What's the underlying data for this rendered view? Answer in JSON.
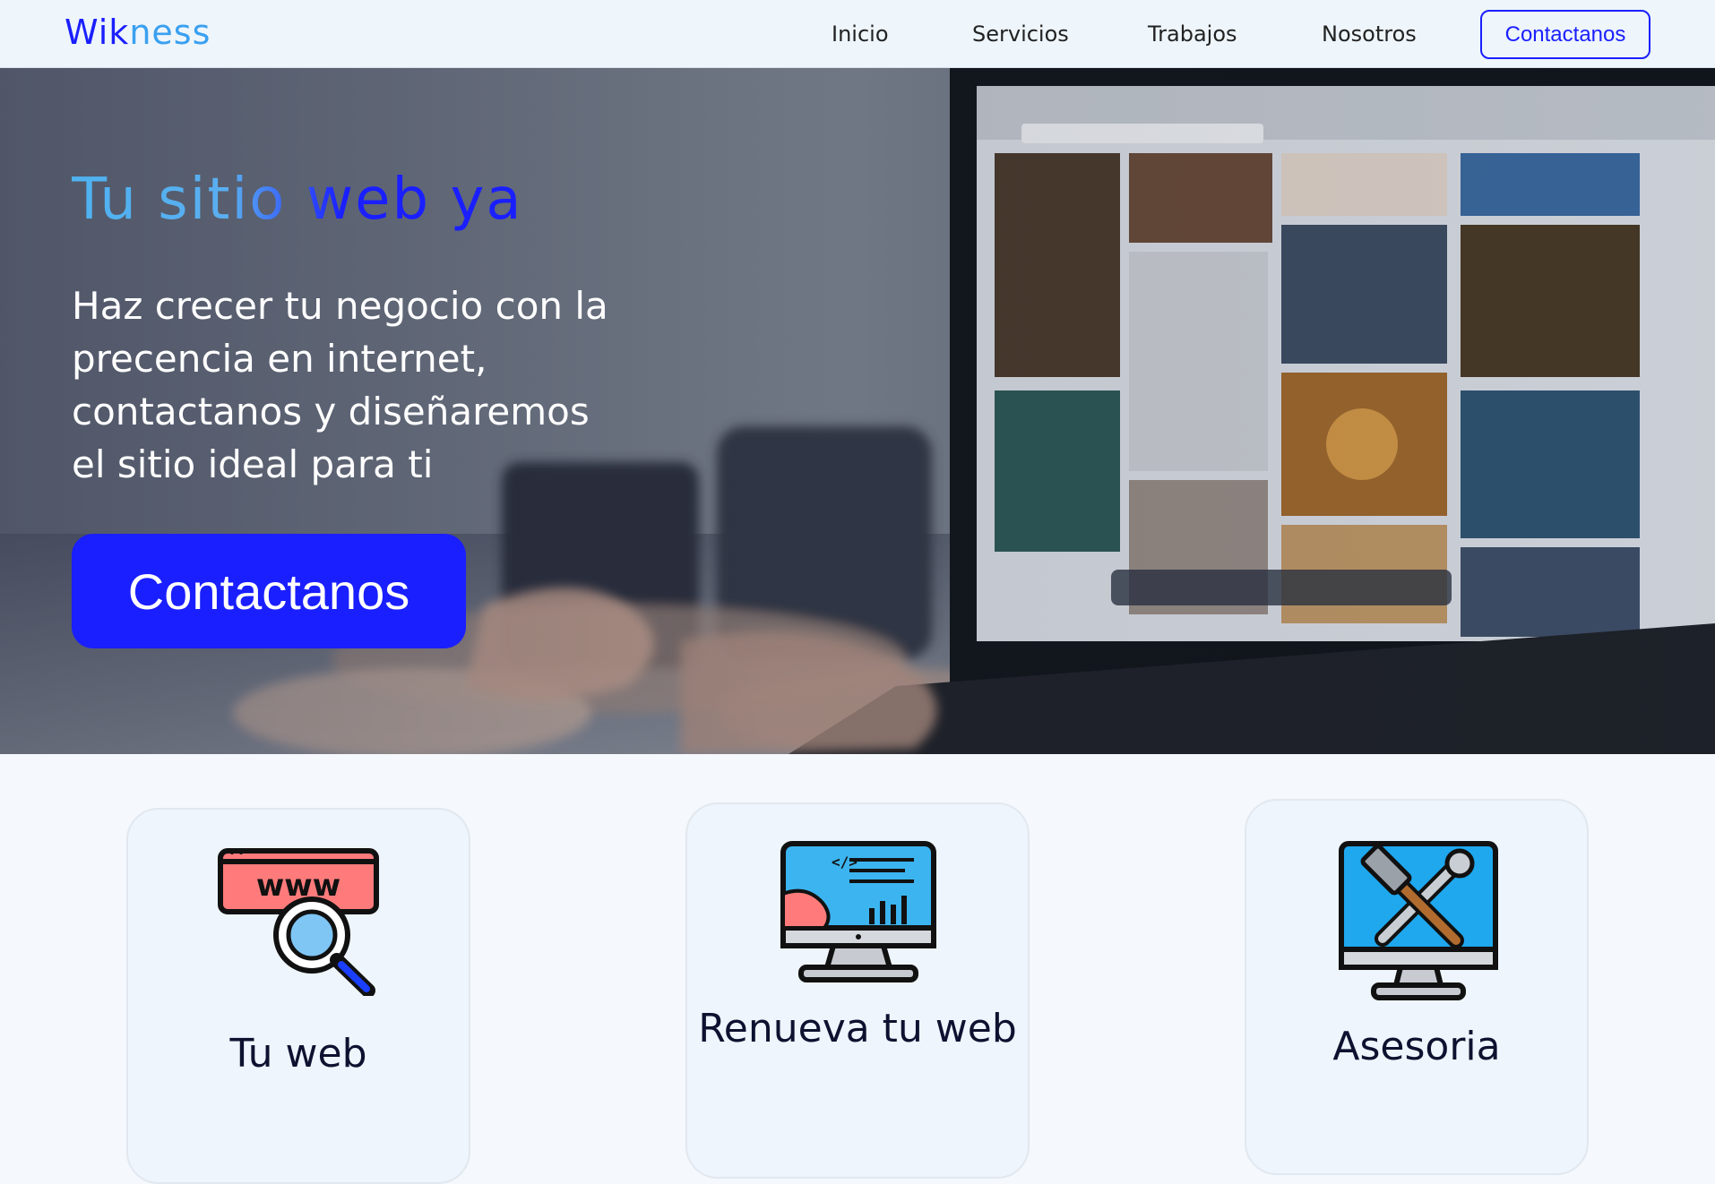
{
  "brand": {
    "part1": "Wik",
    "part2": "ness"
  },
  "nav": {
    "items": [
      "Inicio",
      "Servicios",
      "Trabajos",
      "Nosotros"
    ],
    "cta_label": "Contactanos"
  },
  "hero": {
    "title": "Tu sitio web ya",
    "text": "Haz crecer tu negocio con la precencia en internet, contactanos y diseñaremos el sitio ideal para ti",
    "cta_label": "Contactanos"
  },
  "services": [
    {
      "title": "Tu web",
      "icon": "www-search-icon"
    },
    {
      "title": "Renueva tu web",
      "icon": "monitor-code-icon"
    },
    {
      "title": "Asesoria",
      "icon": "monitor-tools-icon"
    }
  ],
  "colors": {
    "accent": "#1a1fff",
    "light_blue": "#3aa0f0",
    "nav_bg": "#eef5fb"
  }
}
